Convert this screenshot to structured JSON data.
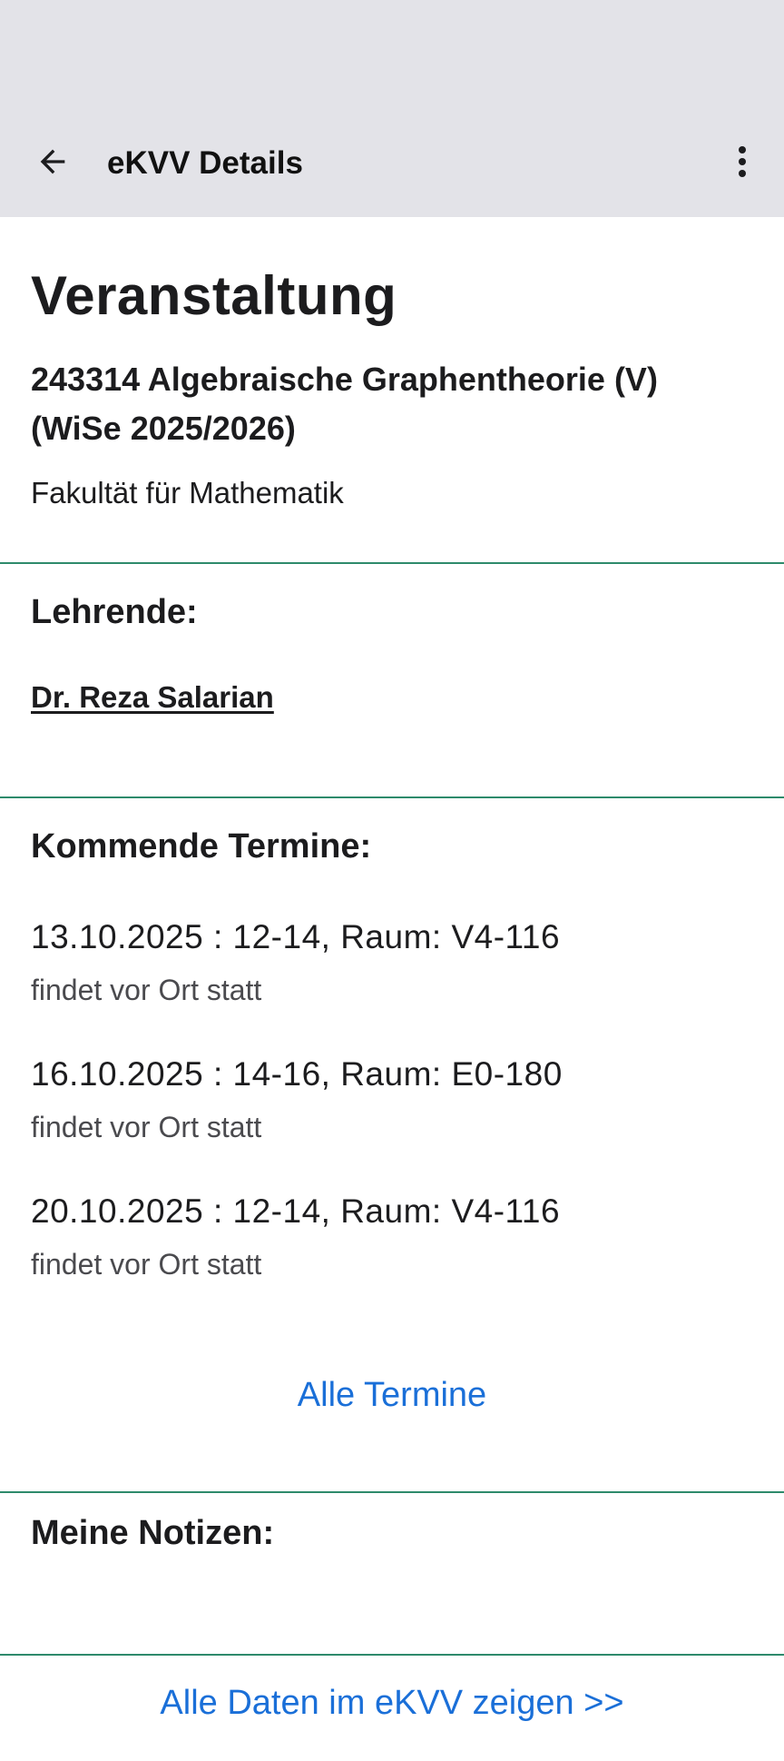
{
  "appbar": {
    "title": "eKVV Details",
    "back_icon": "arrow-left-icon",
    "more_icon": "more-vertical-icon"
  },
  "course": {
    "heading": "Veranstaltung",
    "title": "243314 Algebraische Graphentheorie (V) (WiSe 2025/2026)",
    "faculty": "Fakultät für Mathematik"
  },
  "lecturers": {
    "heading": "Lehrende:",
    "items": [
      "Dr. Reza Salarian"
    ]
  },
  "upcoming": {
    "heading": "Kommende Termine:",
    "items": [
      {
        "line": "13.10.2025 : 12-14, Raum: V4-116",
        "note": "findet vor Ort statt"
      },
      {
        "line": "16.10.2025 : 14-16, Raum: E0-180",
        "note": "findet vor Ort statt"
      },
      {
        "line": "20.10.2025 : 12-14, Raum: V4-116",
        "note": "findet vor Ort statt"
      }
    ],
    "all_link": "Alle Termine"
  },
  "notes": {
    "heading": "Meine Notizen:"
  },
  "footer": {
    "link": "Alle Daten im eKVV zeigen >>"
  },
  "colors": {
    "appbar_bg": "#e3e3e8",
    "divider": "#2e8a6b",
    "link": "#1a6fd8"
  }
}
